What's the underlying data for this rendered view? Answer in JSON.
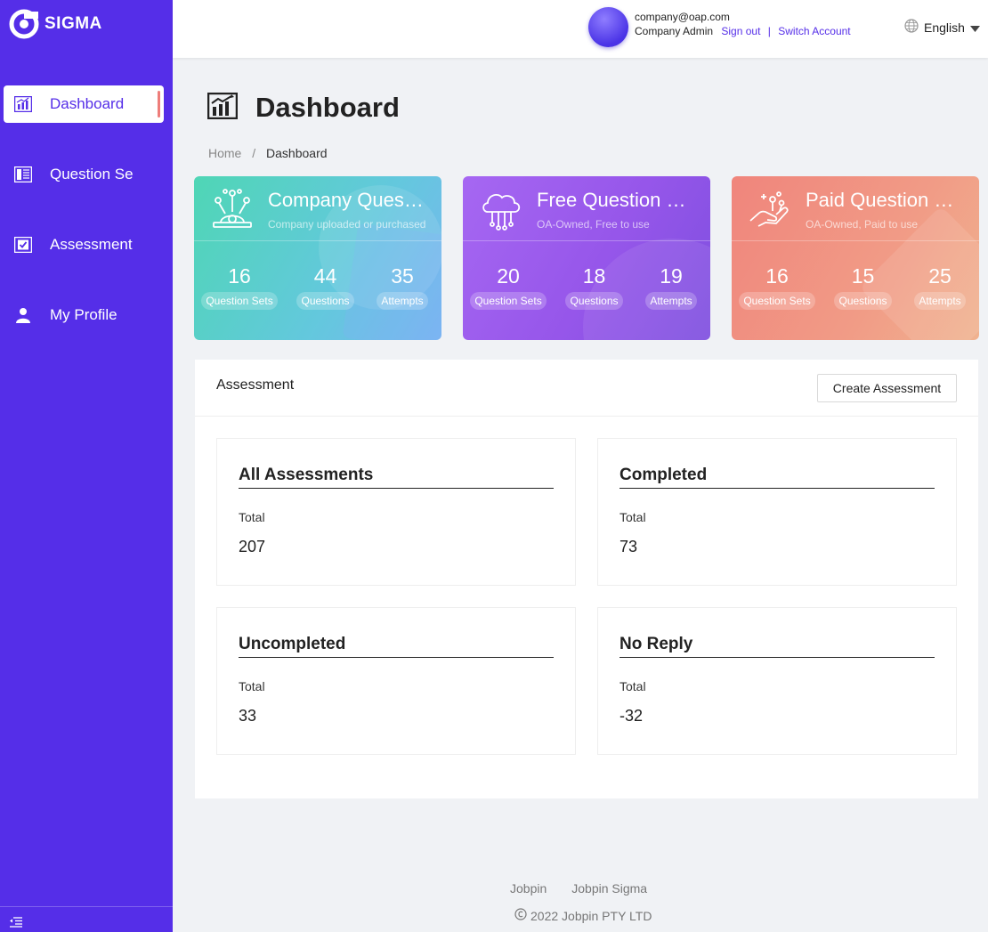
{
  "app": {
    "name": "SIGMA"
  },
  "sidebar": {
    "items": [
      {
        "label": "Dashboard",
        "icon": "chart-icon",
        "active": true
      },
      {
        "label": "Question Se",
        "icon": "book-icon",
        "active": false
      },
      {
        "label": "Assessment",
        "icon": "checkbox-icon",
        "active": false
      },
      {
        "label": "My Profile",
        "icon": "user-icon",
        "active": false
      }
    ]
  },
  "header": {
    "email": "company@oap.com",
    "role": "Company Admin",
    "sign_out": "Sign out",
    "separator": "|",
    "switch_account": "Switch Account",
    "language": "English"
  },
  "page": {
    "title": "Dashboard",
    "breadcrumb": [
      "Home",
      "/",
      "Dashboard"
    ]
  },
  "cards": [
    {
      "title": "Company Question Sets",
      "subtitle": "Company uploaded or purchased",
      "stats": [
        {
          "value": "16",
          "label": "Question Sets"
        },
        {
          "value": "44",
          "label": "Questions"
        },
        {
          "value": "35",
          "label": "Attempts"
        }
      ]
    },
    {
      "title": "Free Question Sets",
      "subtitle": "OA-Owned, Free to use",
      "stats": [
        {
          "value": "20",
          "label": "Question Sets"
        },
        {
          "value": "18",
          "label": "Questions"
        },
        {
          "value": "19",
          "label": "Attempts"
        }
      ]
    },
    {
      "title": "Paid Question Sets",
      "subtitle": "OA-Owned, Paid to use",
      "stats": [
        {
          "value": "16",
          "label": "Question Sets"
        },
        {
          "value": "15",
          "label": "Questions"
        },
        {
          "value": "25",
          "label": "Attempts"
        }
      ]
    }
  ],
  "assessment": {
    "title": "Assessment",
    "create_label": "Create Assessment",
    "boxes": [
      {
        "title": "All Assessments",
        "label": "Total",
        "value": "207"
      },
      {
        "title": "Completed",
        "label": "Total",
        "value": "73"
      },
      {
        "title": "Uncompleted",
        "label": "Total",
        "value": "33"
      },
      {
        "title": "No Reply",
        "label": "Total",
        "value": "-32"
      }
    ]
  },
  "footer": {
    "links": [
      "Jobpin",
      "Jobpin Sigma"
    ],
    "copyright": "2022 Jobpin PTY LTD"
  },
  "colors": {
    "brand": "#552ee8",
    "active_indicator": "#ee7d7a",
    "card_company": "#4fd6b5",
    "card_free": "#9656ea",
    "card_paid": "#f0857c"
  }
}
